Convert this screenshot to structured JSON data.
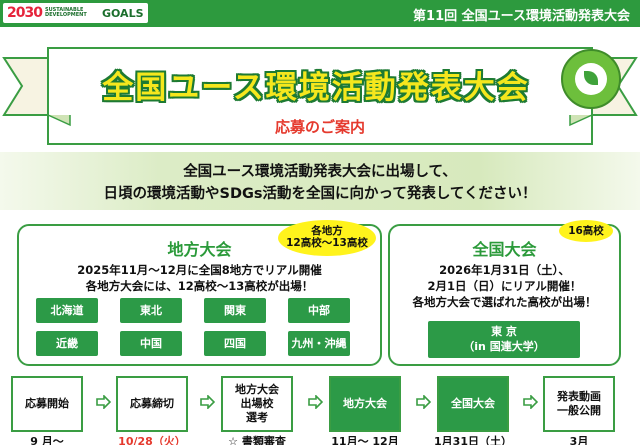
{
  "header": {
    "sdg_number": "2030",
    "sdg_small": "SUSTAINABLE DEVELOPMENT",
    "sdg_goals": "GOALS",
    "title": "第11回  全国ユース環境活動発表大会"
  },
  "banner": {
    "title": "全国ユース環境活動発表大会",
    "subtitle": "応募のご案内"
  },
  "message": {
    "line1": "全国ユース環境活動発表大会に出場して、",
    "line2": "日頃の環境活動やSDGs活動を全国に向かって発表してください！"
  },
  "regional": {
    "title": "地方大会",
    "callout_line1": "各地方",
    "callout_line2": "12高校～13高校",
    "text_line1": "2025年11月～12月に全国8地方でリアル開催",
    "text_line2": "各地方大会には、12高校～13高校が出場！",
    "regions": [
      "北海道",
      "東北",
      "関東",
      "中部",
      "近畿",
      "中国",
      "四国",
      "九州・沖縄"
    ]
  },
  "national": {
    "title": "全国大会",
    "callout": "16高校",
    "text_line1": "2026年1月31日（土）、",
    "text_line2": "2月1日（日）にリアル開催！",
    "text_line3": "各地方大会で選ばれた高校が出場！",
    "venue_line1": "東 京",
    "venue_line2": "（in 国連大学）"
  },
  "flow": {
    "steps": [
      {
        "label": "応募開始",
        "date": "9 月～"
      },
      {
        "label": "応募締切",
        "date": "10/28（火）"
      },
      {
        "label": "地方大会\n出場校\n選考",
        "date": "☆ 書類審査"
      },
      {
        "label": "地方大会",
        "date": "11月～ 12月"
      },
      {
        "label": "全国大会",
        "date": "1月31日（土）"
      },
      {
        "label": "発表動画\n一般公開",
        "date": "3月"
      }
    ]
  },
  "colors": {
    "green": "#2c9a47",
    "dark_green": "#1d7a33",
    "yellow": "#f5e71d",
    "red": "#e53a2e"
  }
}
